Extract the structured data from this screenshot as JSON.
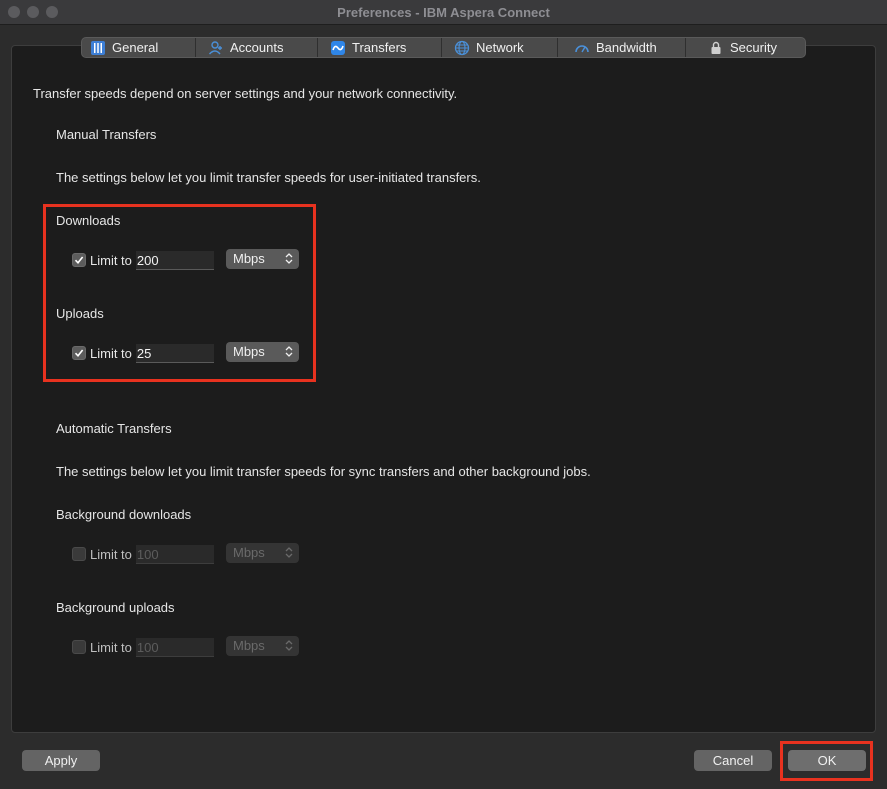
{
  "window": {
    "title": "Preferences - IBM Aspera Connect"
  },
  "tabs": [
    {
      "label": "General",
      "icon": "general-icon"
    },
    {
      "label": "Accounts",
      "icon": "accounts-icon"
    },
    {
      "label": "Transfers",
      "icon": "transfers-icon"
    },
    {
      "label": "Network",
      "icon": "globe-icon"
    },
    {
      "label": "Bandwidth",
      "icon": "gauge-icon"
    },
    {
      "label": "Security",
      "icon": "lock-icon"
    }
  ],
  "content": {
    "intro": "Transfer speeds depend on server settings and your network connectivity.",
    "manual": {
      "heading": "Manual Transfers",
      "desc": "The settings below let you limit transfer speeds for user-initiated transfers.",
      "downloads": {
        "label": "Downloads",
        "checkbox_label": "Limit to",
        "checked": true,
        "value": "200",
        "unit": "Mbps"
      },
      "uploads": {
        "label": "Uploads",
        "checkbox_label": "Limit to",
        "checked": true,
        "value": "25",
        "unit": "Mbps"
      }
    },
    "automatic": {
      "heading": "Automatic Transfers",
      "desc": "The settings below let you limit transfer speeds for sync transfers and other background jobs.",
      "bg_downloads": {
        "label": "Background downloads",
        "checkbox_label": "Limit to",
        "checked": false,
        "value": "100",
        "unit": "Mbps"
      },
      "bg_uploads": {
        "label": "Background uploads",
        "checkbox_label": "Limit to",
        "checked": false,
        "value": "100",
        "unit": "Mbps"
      }
    }
  },
  "buttons": {
    "apply": "Apply",
    "cancel": "Cancel",
    "ok": "OK"
  },
  "colors": {
    "highlight": "#e8321f",
    "tab_icon": "#4a90d9"
  }
}
